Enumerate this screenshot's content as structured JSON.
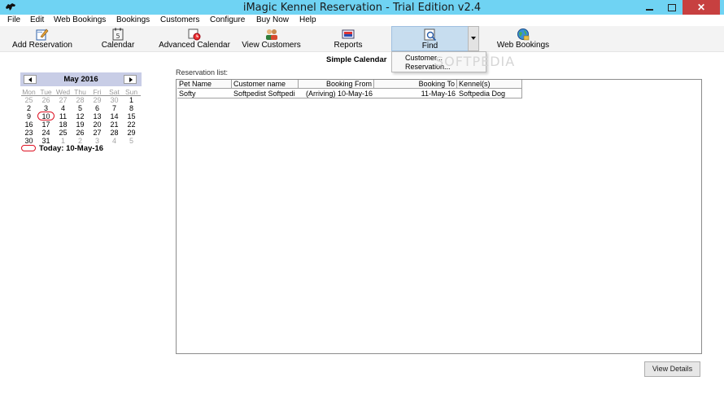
{
  "window": {
    "title": "iMagic Kennel Reservation - Trial Edition v2.4",
    "close_glyph": "✕"
  },
  "menu": {
    "items": [
      "File",
      "Edit",
      "Web Bookings",
      "Bookings",
      "Customers",
      "Configure",
      "Buy Now",
      "Help"
    ]
  },
  "toolbar": {
    "add_reservation": "Add Reservation",
    "calendar": "Calendar",
    "advanced_calendar": "Advanced Calendar",
    "view_customers": "View Customers",
    "reports": "Reports",
    "find": "Find",
    "web_bookings": "Web Bookings"
  },
  "find_menu": {
    "customer": "Customer...",
    "reservation": "Reservation..."
  },
  "watermark": "SOFTPEDIA",
  "simple_calendar_title": "Simple Calendar",
  "calendar": {
    "month_label": "May 2016",
    "days_of_week": [
      "Mon",
      "Tue",
      "Wed",
      "Thu",
      "Fri",
      "Sat",
      "Sun"
    ],
    "weeks": [
      [
        "25",
        "26",
        "27",
        "28",
        "29",
        "30",
        "1"
      ],
      [
        "2",
        "3",
        "4",
        "5",
        "6",
        "7",
        "8"
      ],
      [
        "9",
        "10",
        "11",
        "12",
        "13",
        "14",
        "15"
      ],
      [
        "16",
        "17",
        "18",
        "19",
        "20",
        "21",
        "22"
      ],
      [
        "23",
        "24",
        "25",
        "26",
        "27",
        "28",
        "29"
      ],
      [
        "30",
        "31",
        "1",
        "2",
        "3",
        "4",
        "5"
      ]
    ],
    "today_label": "Today: 10-May-16"
  },
  "reservations": {
    "label": "Reservation list:",
    "columns": [
      "Pet Name",
      "Customer name",
      "Booking From",
      "Booking To",
      "Kennel(s)"
    ],
    "rows": [
      [
        "Softy",
        "Softpedist Softpedi",
        "(Arriving) 10-May-16",
        "11-May-16",
        "Softpedia Dog"
      ]
    ]
  },
  "buttons": {
    "view_details": "View Details"
  },
  "colors": {
    "titlebar": "#6fd3f3",
    "calendar_header": "#c8cde6",
    "today_ring": "#dd1122",
    "close_button": "#c74040"
  }
}
